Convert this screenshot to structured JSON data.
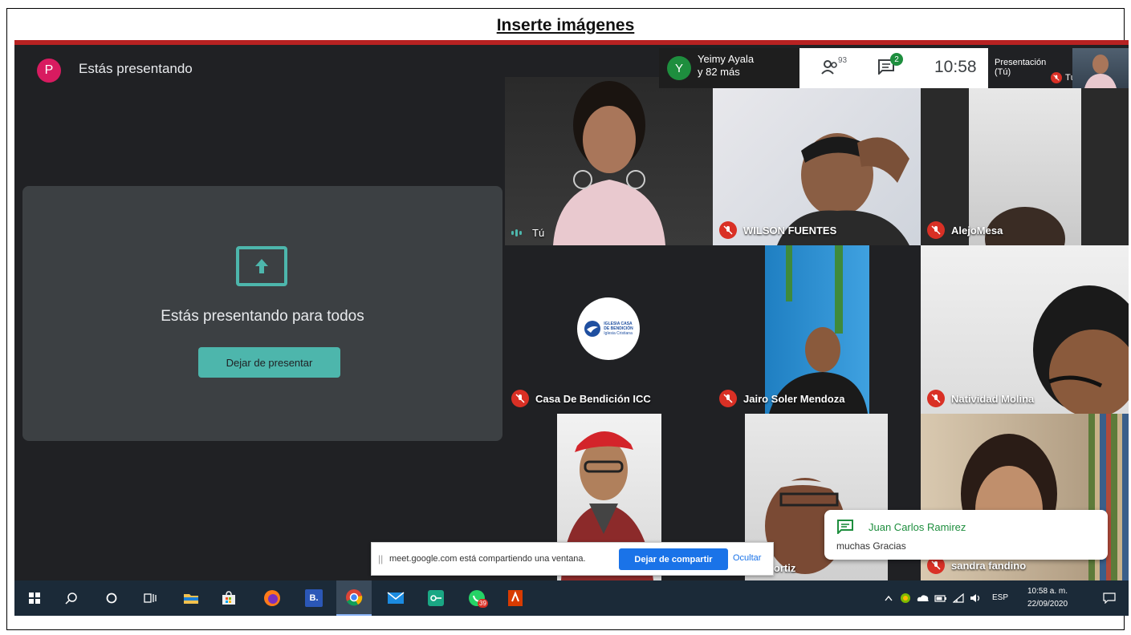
{
  "document": {
    "title": "Inserte imágenes"
  },
  "meet": {
    "presenting_title": "Estás presentando",
    "presenter_initial": "P",
    "present_card": {
      "message": "Estás presentando para todos",
      "stop_button": "Dejar de presentar"
    },
    "top_bar": {
      "viewer_initial": "Y",
      "viewer_name": "Yeimy Ayala",
      "viewer_more": "y 82 más",
      "people_count": "93",
      "chat_badge": "2",
      "time": "10:58",
      "self_presentation_line1": "Presentación",
      "self_presentation_line2": "(Tú)",
      "self_label": "Tú"
    },
    "tiles": [
      {
        "name": "Tú",
        "muted": false
      },
      {
        "name": "WILSON FUENTES",
        "muted": true
      },
      {
        "name": "AlejoMesa",
        "muted": true
      },
      {
        "name": "Casa De Bendición ICC",
        "muted": true
      },
      {
        "name": "Jairo Soler Mendoza",
        "muted": true
      },
      {
        "name": "Natividad Molina",
        "muted": true
      },
      {
        "name": "",
        "muted": true
      },
      {
        "name": "cesar tello ortiz",
        "muted": true
      },
      {
        "name": "sandra fandino",
        "muted": true
      }
    ],
    "logo_lines": [
      "IGLESIA CASA",
      "DE BENDICIÓN",
      "Iglesia Cristiana"
    ],
    "share_bar": {
      "text": "meet.google.com está compartiendo una ventana.",
      "stop_share": "Dejar de compartir",
      "hide": "Ocultar"
    },
    "chat_toast": {
      "sender": "Juan Carlos Ramirez",
      "message": "muchas Gracias"
    }
  },
  "taskbar": {
    "tray_lang": "ESP",
    "tray_time": "10:58 a. m.",
    "tray_date": "22/09/2020",
    "whatsapp_badge": "39",
    "b_label": "B."
  },
  "colors": {
    "accent_teal": "#4db6ac",
    "mute_red": "#d93025",
    "meet_dark": "#202124",
    "taskbar": "#1b2a38"
  }
}
